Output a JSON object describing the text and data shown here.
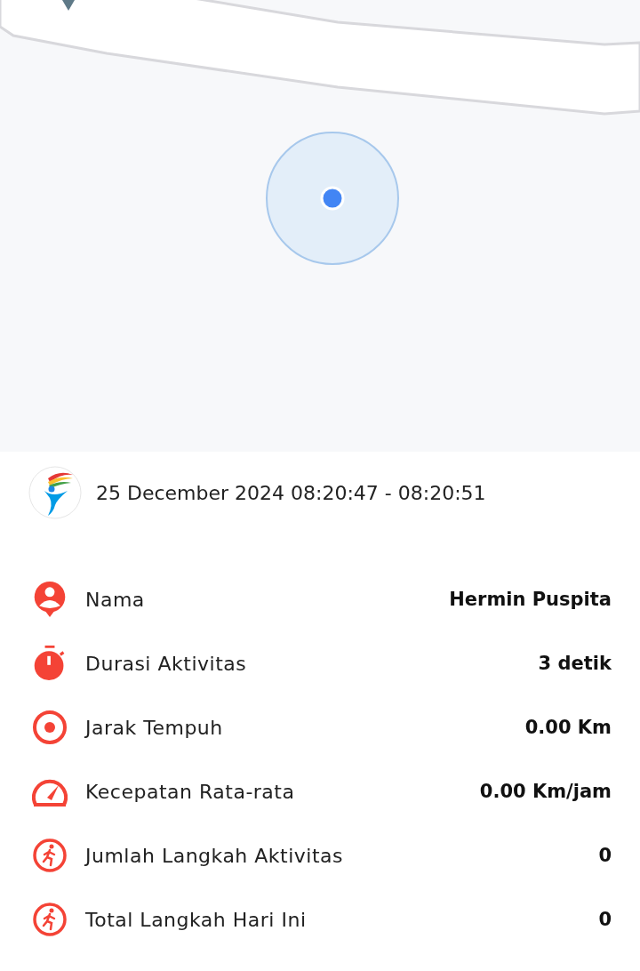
{
  "session": {
    "datetime": "25 December 2024 08:20:47 - 08:20:51"
  },
  "stats": [
    {
      "kind": "person",
      "label": "Nama",
      "value": "Hermin Puspita"
    },
    {
      "kind": "stopwatch",
      "label": "Durasi Aktivitas",
      "value": "3 detik"
    },
    {
      "kind": "target",
      "label": "Jarak Tempuh",
      "value": "0.00 Km"
    },
    {
      "kind": "gauge",
      "label": "Kecepatan Rata-rata",
      "value": "0.00 Km/jam"
    },
    {
      "kind": "runner",
      "label": "Jumlah Langkah Aktivitas",
      "value": "0"
    },
    {
      "kind": "runner",
      "label": "Total Langkah Hari Ini",
      "value": "0"
    }
  ]
}
